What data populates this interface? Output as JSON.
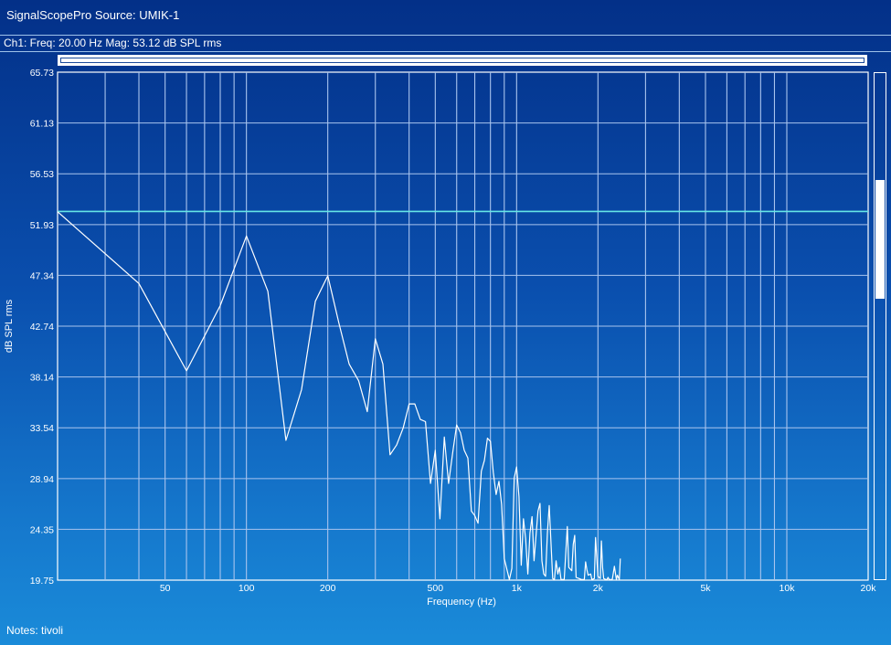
{
  "window": {
    "title": "SignalScopePro Source:  UMIK-1"
  },
  "status": {
    "readout": "Ch1:  Freq: 20.00 Hz   Mag: 53.12 dB SPL rms"
  },
  "notes": {
    "text": "Notes: tivoli"
  },
  "colors": {
    "trace": "#ffffff",
    "cursor": "#66e6e6",
    "grid": "#a9c4ee"
  },
  "chart_data": {
    "type": "line",
    "xlabel": "Frequency (Hz)",
    "ylabel": "dB SPL rms",
    "x_scale": "log",
    "xlim": [
      20,
      20000
    ],
    "ylim": [
      19.75,
      65.73
    ],
    "grid": true,
    "x_tick_labels": [
      {
        "value": 50,
        "label": "50"
      },
      {
        "value": 100,
        "label": "100"
      },
      {
        "value": 200,
        "label": "200"
      },
      {
        "value": 500,
        "label": "500"
      },
      {
        "value": 1000,
        "label": "1k"
      },
      {
        "value": 2000,
        "label": "2k"
      },
      {
        "value": 5000,
        "label": "5k"
      },
      {
        "value": 10000,
        "label": "10k"
      },
      {
        "value": 20000,
        "label": "20k"
      }
    ],
    "y_ticks": [
      19.75,
      24.35,
      28.94,
      33.54,
      38.14,
      42.74,
      47.34,
      51.93,
      56.53,
      61.13,
      65.73
    ],
    "y_tick_labels": [
      "19.75",
      "24.35",
      "28.94",
      "33.54",
      "38.14",
      "42.74",
      "47.34",
      "51.93",
      "56.53",
      "61.13",
      "65.73"
    ],
    "cursor_level": 53.12,
    "series": [
      {
        "x": [
          20,
          40,
          60,
          80,
          100,
          120,
          140,
          160,
          180,
          200,
          220,
          240,
          260,
          280,
          300,
          320,
          340,
          360,
          380,
          400,
          420,
          440,
          460,
          480,
          500,
          520,
          540,
          560,
          580,
          600,
          620,
          640,
          660,
          680,
          700,
          720,
          740,
          760,
          780,
          800,
          820,
          840,
          860,
          880,
          900,
          940,
          960,
          980,
          1000,
          1020,
          1040,
          1060,
          1080,
          1100,
          1120,
          1140,
          1160,
          1200,
          1220,
          1240,
          1260,
          1280,
          1300,
          1320,
          1360,
          1380,
          1400,
          1420,
          1440,
          1460,
          1500,
          1540,
          1560,
          1600,
          1620,
          1640,
          1660,
          1700,
          1740,
          1780,
          1800,
          1820,
          1840,
          1880,
          1900,
          1940,
          1960,
          2000,
          2040,
          2060,
          2080,
          2100,
          2140,
          2160,
          2180,
          2200,
          2220,
          2260,
          2300,
          2340,
          2360,
          2400,
          2420
        ],
        "y": [
          53.1,
          46.6,
          38.7,
          44.6,
          50.9,
          45.9,
          32.4,
          37.0,
          45.0,
          47.3,
          43.0,
          39.3,
          37.8,
          35.0,
          41.6,
          39.3,
          31.1,
          32.0,
          33.5,
          35.7,
          35.7,
          34.3,
          34.1,
          28.5,
          31.5,
          25.3,
          32.7,
          28.5,
          31.3,
          33.8,
          33.1,
          31.5,
          30.8,
          26.0,
          25.6,
          24.9,
          29.6,
          30.6,
          32.6,
          32.3,
          29.5,
          27.5,
          28.7,
          26.6,
          21.7,
          19.8,
          20.8,
          29.0,
          30.0,
          27.3,
          21.1,
          25.3,
          23.5,
          20.3,
          24.0,
          25.5,
          21.5,
          26.0,
          26.7,
          21.5,
          20.3,
          20.1,
          24.0,
          26.5,
          19.9,
          19.8,
          21.5,
          20.3,
          20.9,
          19.8,
          19.8,
          24.6,
          20.9,
          20.6,
          23.0,
          23.8,
          20.0,
          19.9,
          19.8,
          19.8,
          21.4,
          20.7,
          20.2,
          20.3,
          19.8,
          19.9,
          23.6,
          20.1,
          19.9,
          23.3,
          20.9,
          19.9,
          19.8,
          19.8,
          20.0,
          19.8,
          19.8,
          19.8,
          21.0,
          19.8,
          20.2,
          19.8,
          21.7
        ]
      }
    ]
  }
}
